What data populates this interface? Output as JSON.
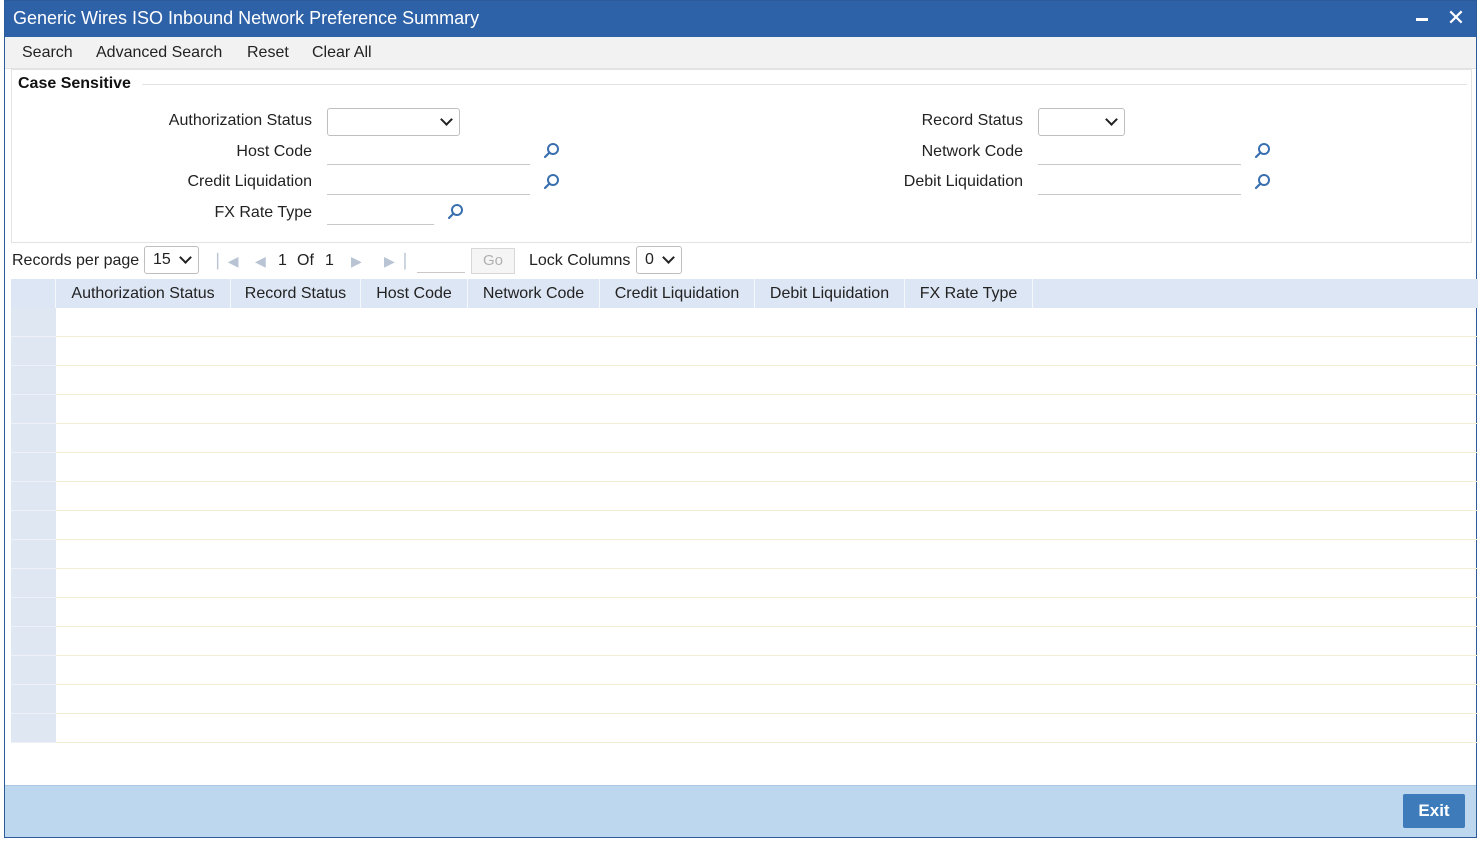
{
  "window": {
    "title": "Generic Wires ISO Inbound Network Preference Summary"
  },
  "toolbar": {
    "search": "Search",
    "advanced_search": "Advanced Search",
    "reset": "Reset",
    "clear_all": "Clear All"
  },
  "panel": {
    "legend": "Case Sensitive",
    "fields": {
      "authorization_status": {
        "label": "Authorization Status",
        "value": ""
      },
      "record_status": {
        "label": "Record Status",
        "value": ""
      },
      "host_code": {
        "label": "Host Code",
        "value": ""
      },
      "network_code": {
        "label": "Network Code",
        "value": ""
      },
      "credit_liquidation": {
        "label": "Credit Liquidation",
        "value": ""
      },
      "debit_liquidation": {
        "label": "Debit Liquidation",
        "value": ""
      },
      "fx_rate_type": {
        "label": "FX Rate Type",
        "value": ""
      }
    }
  },
  "pager": {
    "records_per_page_label": "Records per page",
    "records_per_page_value": "15",
    "current_page": "1",
    "of_label": "Of",
    "total_pages": "1",
    "go_label": "Go",
    "lock_columns_label": "Lock Columns",
    "lock_columns_value": "0"
  },
  "grid": {
    "columns": [
      "Authorization Status",
      "Record Status",
      "Host Code",
      "Network Code",
      "Credit Liquidation",
      "Debit Liquidation",
      "FX Rate Type"
    ],
    "row_count": 15
  },
  "footer": {
    "exit_label": "Exit"
  },
  "colors": {
    "title_bar": "#2e62a8",
    "footer": "#bcd7ee",
    "exit_button": "#3d7bba",
    "grid_header": "#dde6f4"
  },
  "icons": {
    "lookup": "magnifier-icon",
    "close": "close-icon",
    "minimize": "minimize-icon"
  }
}
